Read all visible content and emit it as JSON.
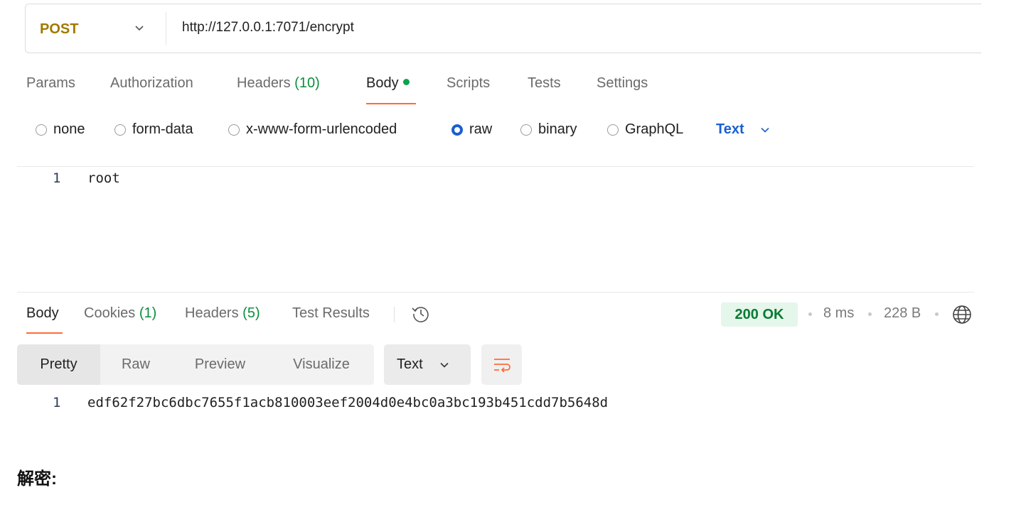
{
  "request": {
    "method": "POST",
    "url": "http://127.0.0.1:7071/encrypt",
    "tabs": [
      {
        "label": "Params",
        "count": ""
      },
      {
        "label": "Authorization",
        "count": ""
      },
      {
        "label": "Headers",
        "count": "(10)"
      },
      {
        "label": "Body",
        "count": ""
      },
      {
        "label": "Scripts",
        "count": ""
      },
      {
        "label": "Tests",
        "count": ""
      },
      {
        "label": "Settings",
        "count": ""
      }
    ],
    "active_tab": "Body",
    "body_types": [
      "none",
      "form-data",
      "x-www-form-urlencoded",
      "raw",
      "binary",
      "GraphQL"
    ],
    "selected_body_type": "raw",
    "raw_format": "Text",
    "body_lines": [
      {
        "num": "1",
        "text": "root"
      }
    ]
  },
  "response": {
    "tabs": [
      {
        "label": "Body",
        "count": ""
      },
      {
        "label": "Cookies",
        "count": "(1)"
      },
      {
        "label": "Headers",
        "count": "(5)"
      },
      {
        "label": "Test Results",
        "count": ""
      }
    ],
    "active_tab": "Body",
    "status": "200 OK",
    "time": "8 ms",
    "size": "228 B",
    "view_modes": [
      "Pretty",
      "Raw",
      "Preview",
      "Visualize"
    ],
    "active_view": "Pretty",
    "format": "Text",
    "body_lines": [
      {
        "num": "1",
        "text": "edf62f27bc6dbc7655f1acb810003eef2004d0e4bc0a3bc193b451cdd7b5648d"
      }
    ]
  },
  "heading": "解密:",
  "colors": {
    "accent_orange": "#ff6c37",
    "method": "#a07a00",
    "link_blue": "#1b5fd0",
    "success_green": "#0a8f3c"
  },
  "icons": [
    "chevron-down-icon",
    "history-icon",
    "globe-icon",
    "wrap-lines-icon"
  ]
}
